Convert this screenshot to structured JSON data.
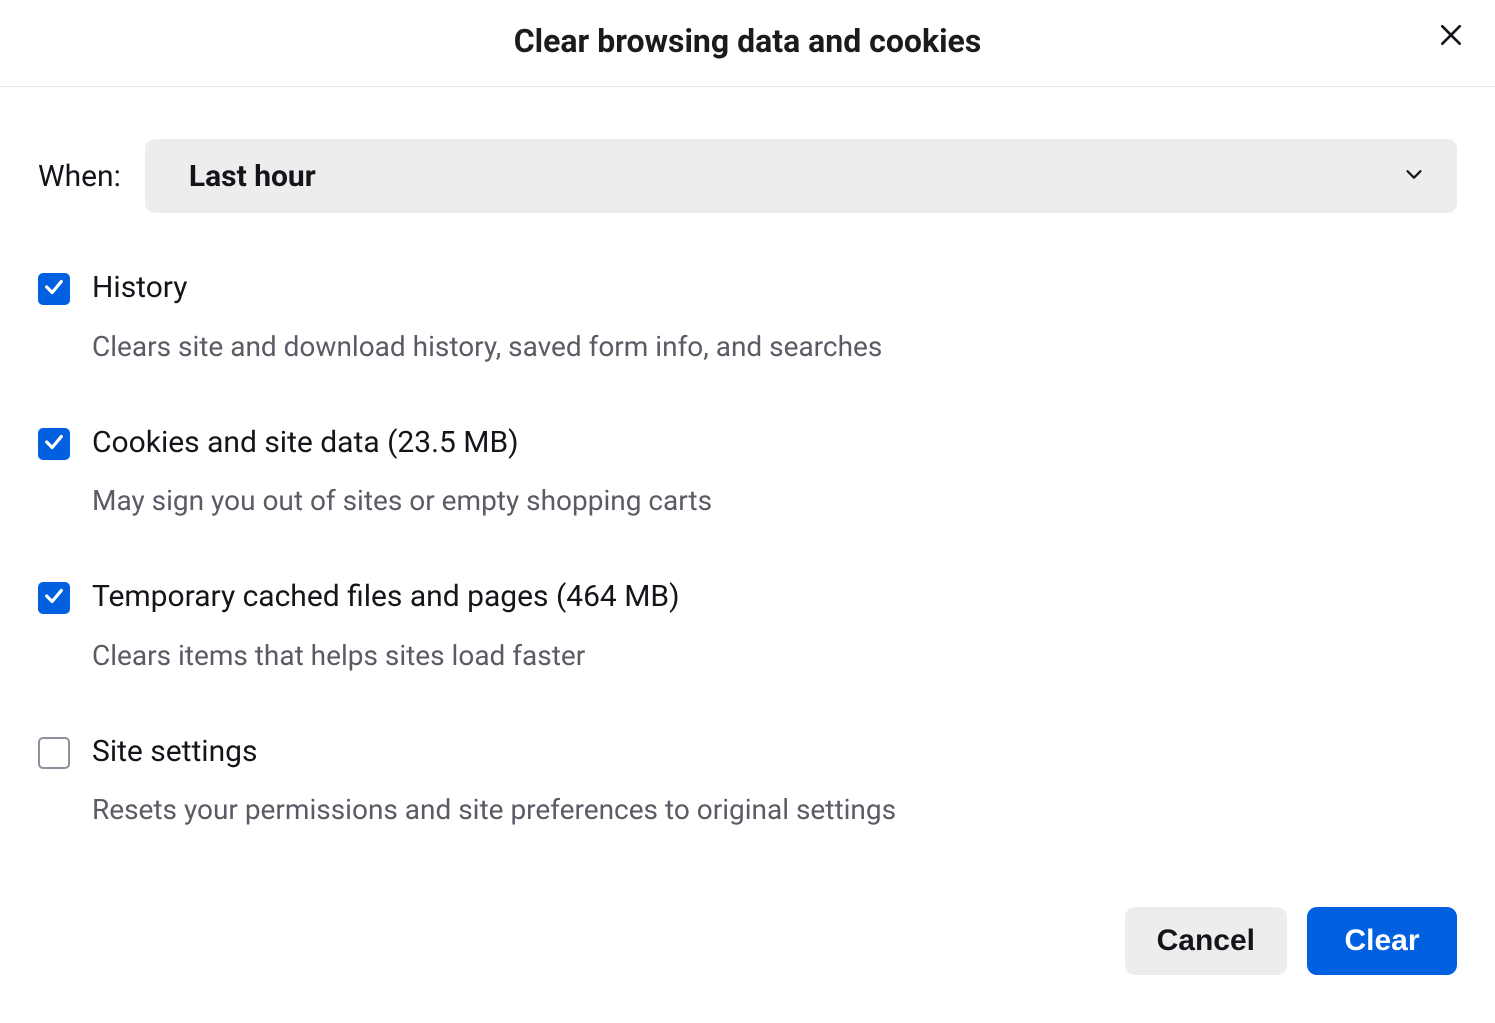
{
  "dialog": {
    "title": "Clear browsing data and cookies"
  },
  "when": {
    "label": "When:",
    "value": "Last hour"
  },
  "options": [
    {
      "label": "History",
      "description": "Clears site and download history, saved form info, and searches",
      "checked": true
    },
    {
      "label": "Cookies and site data (23.5 MB)",
      "description": "May sign you out of sites or empty shopping carts",
      "checked": true
    },
    {
      "label": "Temporary cached files and pages (464 MB)",
      "description": "Clears items that helps sites load faster",
      "checked": true
    },
    {
      "label": "Site settings",
      "description": "Resets your permissions and site preferences to original settings",
      "checked": false
    }
  ],
  "buttons": {
    "cancel": "Cancel",
    "clear": "Clear"
  }
}
